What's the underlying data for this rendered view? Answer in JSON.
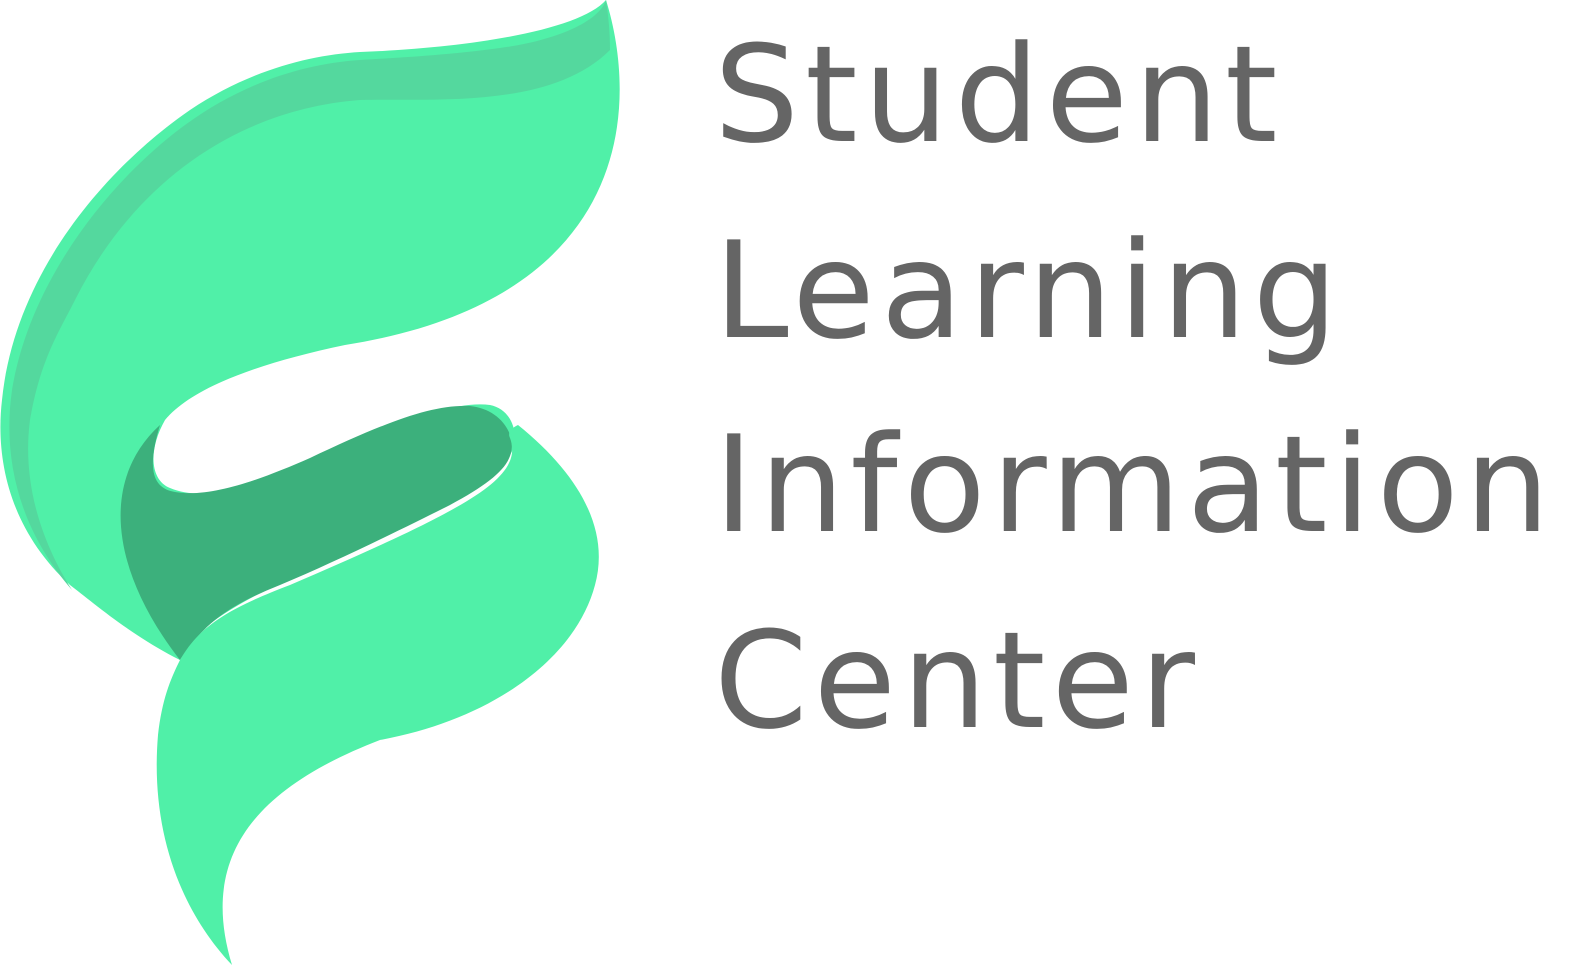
{
  "logo": {
    "mark_icon": "green-leaf-ribbon-icon",
    "colors": {
      "primary_green": "#50F0A8",
      "highlight_green": "#54D89E",
      "shadow_green": "#3CB07C",
      "text_gray": "#656565"
    },
    "wordmark": {
      "line1": "Student",
      "line2": "Learning",
      "line3": "Information",
      "line4": "Center"
    }
  }
}
